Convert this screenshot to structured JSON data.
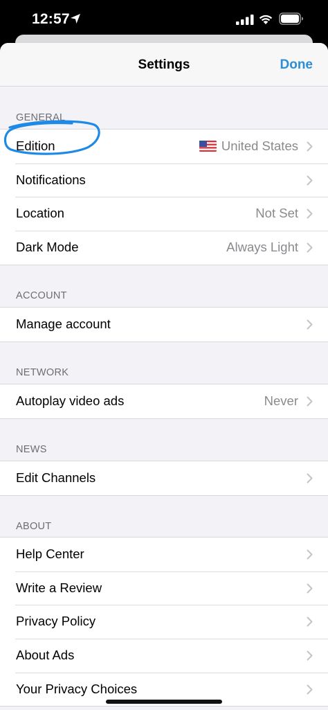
{
  "status_bar": {
    "time": "12:57"
  },
  "nav": {
    "title": "Settings",
    "done_label": "Done"
  },
  "sections": {
    "general": {
      "header": "GENERAL",
      "edition_label": "Edition",
      "edition_value": "United States",
      "notifications_label": "Notifications",
      "location_label": "Location",
      "location_value": "Not Set",
      "dark_mode_label": "Dark Mode",
      "dark_mode_value": "Always Light"
    },
    "account": {
      "header": "ACCOUNT",
      "manage_label": "Manage account"
    },
    "network": {
      "header": "NETWORK",
      "autoplay_label": "Autoplay video ads",
      "autoplay_value": "Never"
    },
    "news": {
      "header": "NEWS",
      "edit_channels_label": "Edit Channels"
    },
    "about": {
      "header": "ABOUT",
      "help_label": "Help Center",
      "review_label": "Write a Review",
      "privacy_label": "Privacy Policy",
      "ads_label": "About Ads",
      "choices_label": "Your Privacy Choices"
    }
  },
  "colors": {
    "accent": "#2c8fd6",
    "annotation": "#1e8ae6",
    "background": "#f2f2f7",
    "secondary_text": "#8a8a8e"
  },
  "icons": [
    "location-arrow-icon",
    "signal-icon",
    "wifi-icon",
    "battery-icon",
    "us-flag-icon",
    "chevron-right-icon"
  ]
}
